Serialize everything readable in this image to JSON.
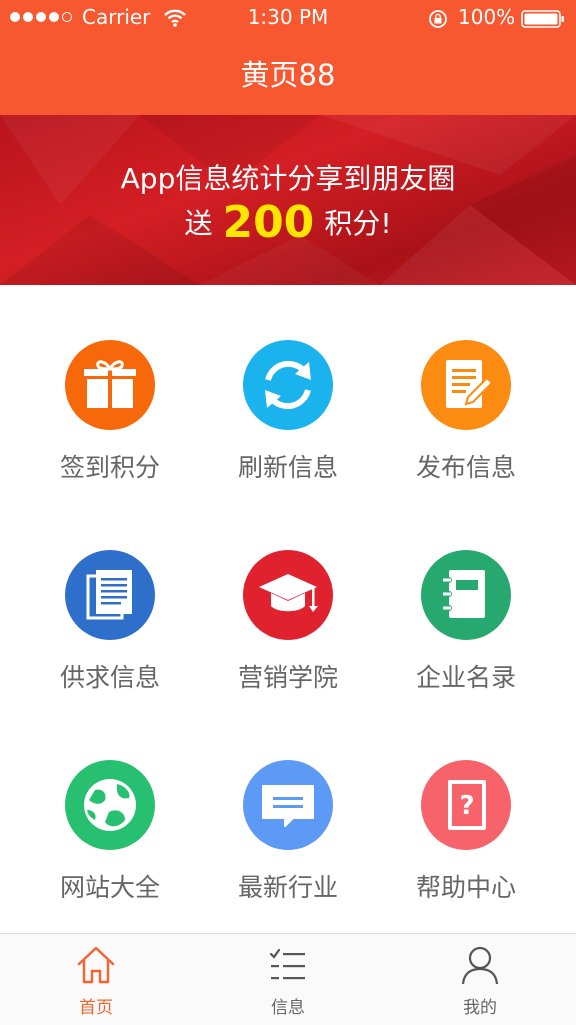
{
  "status": {
    "carrier": "Carrier",
    "time": "1:30 PM",
    "battery": "100%"
  },
  "header": {
    "title": "黄页88"
  },
  "banner": {
    "line1": "App信息统计分享到朋友圈",
    "line2_prefix": "送",
    "line2_number": "200",
    "line2_suffix": "积分!"
  },
  "grid": {
    "items": [
      {
        "label": "签到积分",
        "icon": "gift-icon",
        "color": "#f7680a"
      },
      {
        "label": "刷新信息",
        "icon": "refresh-icon",
        "color": "#1ab3ee"
      },
      {
        "label": "发布信息",
        "icon": "edit-document-icon",
        "color": "#fc8b11"
      },
      {
        "label": "供求信息",
        "icon": "documents-icon",
        "color": "#2f6fcc"
      },
      {
        "label": "营销学院",
        "icon": "graduation-cap-icon",
        "color": "#e0222e"
      },
      {
        "label": "企业名录",
        "icon": "notebook-icon",
        "color": "#26a86f"
      },
      {
        "label": "网站大全",
        "icon": "globe-icon",
        "color": "#27c070"
      },
      {
        "label": "最新行业",
        "icon": "message-icon",
        "color": "#5d9af5"
      },
      {
        "label": "帮助中心",
        "icon": "help-book-icon",
        "color": "#f7636a"
      }
    ]
  },
  "tabbar": {
    "tabs": [
      {
        "label": "首页",
        "icon": "home-icon",
        "active": true
      },
      {
        "label": "信息",
        "icon": "list-icon",
        "active": false
      },
      {
        "label": "我的",
        "icon": "user-icon",
        "active": false
      }
    ]
  },
  "colors": {
    "primary": "#f7582f",
    "tab_active": "#f7632f"
  }
}
